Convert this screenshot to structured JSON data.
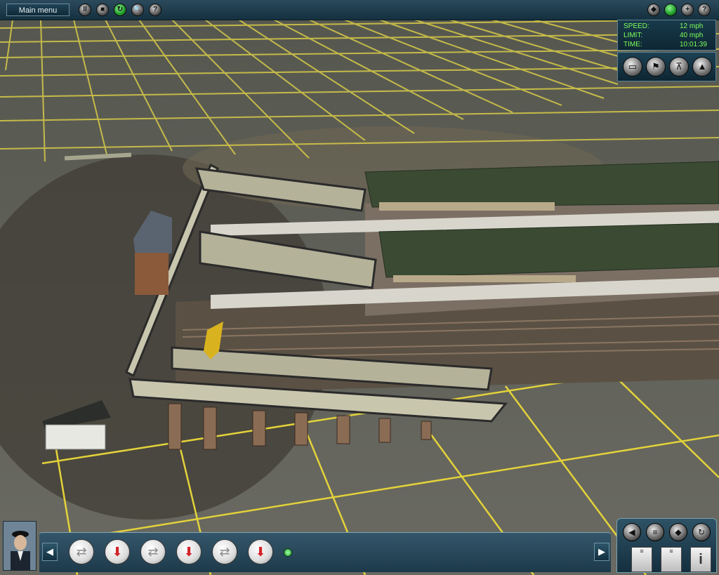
{
  "top_bar": {
    "main_menu_label": "Main menu",
    "left_buttons": [
      {
        "name": "pause-button",
        "icon": "pause-icon",
        "glyph": "II"
      },
      {
        "name": "stop-button",
        "icon": "stop-icon",
        "glyph": "■"
      },
      {
        "name": "driver-mode-button",
        "icon": "cycle-icon",
        "glyph": "↻"
      },
      {
        "name": "search-button",
        "icon": "magnify-icon",
        "glyph": "🔍"
      },
      {
        "name": "help-button",
        "icon": "question-icon",
        "glyph": "?"
      }
    ],
    "right_buttons": [
      {
        "name": "layers-button",
        "icon": "layers-icon",
        "glyph": "◆"
      },
      {
        "name": "status-light-button",
        "icon": "green-light-icon",
        "glyph": ""
      },
      {
        "name": "zoom-in-button",
        "icon": "plus-icon",
        "glyph": "+"
      },
      {
        "name": "help-button-right",
        "icon": "question-icon",
        "glyph": "?"
      }
    ]
  },
  "hud": {
    "speed_label": "SPEED:",
    "speed_value": "12 mph",
    "limit_label": "LIMIT:",
    "limit_value": "40 mph",
    "time_label": "TIME:",
    "time_value": "10:01:39",
    "text_color": "#7dff5a"
  },
  "camera_buttons": [
    {
      "name": "camera-cab-button",
      "icon": "train-icon",
      "glyph": "▭"
    },
    {
      "name": "camera-flag-button",
      "icon": "flag-icon",
      "glyph": "⚑"
    },
    {
      "name": "camera-tripod-button",
      "icon": "tripod-icon",
      "glyph": "⊼"
    },
    {
      "name": "camera-compass-button",
      "icon": "compass-icon",
      "glyph": "▲"
    }
  ],
  "toolbar": {
    "tools": [
      {
        "name": "track-tool-1",
        "icon": "rail-symbol-icon",
        "glyph": "⇄",
        "red": false
      },
      {
        "name": "platform-tool-1",
        "icon": "platform-icon",
        "glyph": "⬇",
        "red": true
      },
      {
        "name": "track-tool-2",
        "icon": "rail-symbol-icon",
        "glyph": "⇄",
        "red": false
      },
      {
        "name": "platform-tool-2",
        "icon": "platform-icon",
        "glyph": "⬇",
        "red": true
      },
      {
        "name": "track-tool-3",
        "icon": "rail-symbol-icon",
        "glyph": "⇄",
        "red": false
      },
      {
        "name": "platform-tool-3",
        "icon": "platform-icon",
        "glyph": "⬇",
        "red": true
      }
    ],
    "left_arrow": "◀",
    "right_arrow": "▶"
  },
  "right_panel": {
    "buttons": [
      {
        "name": "sound-button",
        "icon": "speaker-icon",
        "glyph": "◀"
      },
      {
        "name": "tracks-button",
        "icon": "tracks-icon",
        "glyph": "≡"
      },
      {
        "name": "direction-button",
        "icon": "diamond-icon",
        "glyph": "◆"
      },
      {
        "name": "rotate-button",
        "icon": "rotate-icon",
        "glyph": "↻"
      }
    ],
    "docs": [
      {
        "name": "timetable-doc",
        "icon": "document-icon",
        "glyph": "≡"
      },
      {
        "name": "notes-doc",
        "icon": "document-icon",
        "glyph": "≡"
      },
      {
        "name": "info-doc",
        "icon": "info-icon",
        "glyph": "i"
      }
    ]
  },
  "colors": {
    "grid": "#e6d23c",
    "roof": "#3b4a33",
    "ground": "#8b8375"
  }
}
